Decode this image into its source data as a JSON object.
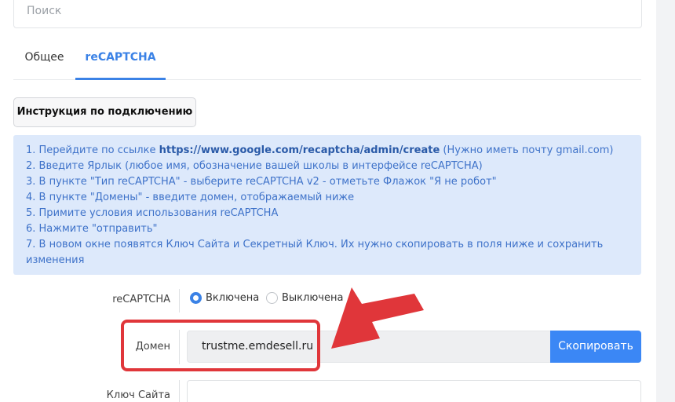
{
  "search": {
    "placeholder": "Поиск"
  },
  "tabs": [
    {
      "label": "Общее"
    },
    {
      "label": "reCAPTCHA"
    }
  ],
  "instructions_button": {
    "label": "Инструкция по подключению"
  },
  "info": {
    "line1_prefix": "1. Перейдите по ссылке ",
    "line1_link": "https://www.google.com/recaptcha/admin/create",
    "line1_suffix": " (Нужно иметь почту gmail.com)",
    "line2": "2. Введите Ярлык (любое имя, обозначение вашей школы в интерфейсе reCAPTCHA)",
    "line3": "3. В пункте \"Тип reCAPTCHA\" - выберите reCAPTCHA v2 - отметьте Флажок \"Я не робот\"",
    "line4": "4. В пункте \"Домены\" - введите домен, отображаемый ниже",
    "line5": "5. Примите условия использования reCAPTCHA",
    "line6": "6. Нажмите \"отправить\"",
    "line7": "7. В новом окне появятся Ключ Сайта и Секретный Ключ. Их нужно скопировать в поля ниже и сохранить изменения"
  },
  "recaptcha_row": {
    "label": "reCAPTCHA",
    "option_on": "Включена",
    "option_off": "Выключена",
    "selected": "Включена"
  },
  "domain_row": {
    "label": "Домен",
    "value": "trustme.emdesell.ru",
    "copy_label": "Скопировать"
  },
  "site_key_row": {
    "label": "Ключ Сайта",
    "value": ""
  },
  "colors": {
    "accent": "#3b82e6",
    "highlight": "#e0363a",
    "info_bg": "#dde9fb"
  }
}
